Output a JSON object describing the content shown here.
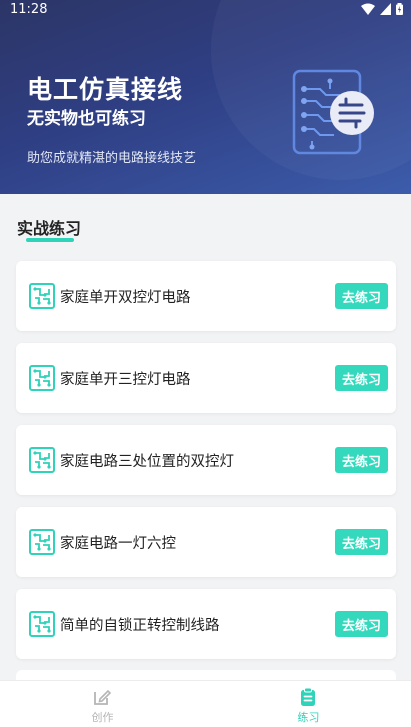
{
  "status": {
    "time": "11:28"
  },
  "hero": {
    "title": "电工仿真接线",
    "subtitle": "无实物也可练习",
    "description": "助您成就精湛的电路接线技艺"
  },
  "section": {
    "title": "实战练习"
  },
  "practice_items": [
    {
      "label": "家庭单开双控灯电路",
      "button": "去练习"
    },
    {
      "label": "家庭单开三控灯电路",
      "button": "去练习"
    },
    {
      "label": "家庭电路三处位置的双控灯",
      "button": "去练习"
    },
    {
      "label": "家庭电路一灯六控",
      "button": "去练习"
    },
    {
      "label": "简单的自锁正转控制线路",
      "button": "去练习"
    }
  ],
  "tabs": [
    {
      "label": "创作",
      "icon": "edit-icon",
      "active": false
    },
    {
      "label": "练习",
      "icon": "clipboard-icon",
      "active": true
    }
  ],
  "colors": {
    "accent": "#34d9bd",
    "hero_start": "#2c3566",
    "hero_end": "#3c5cab",
    "tab_active": "#2fd3ba",
    "tab_inactive": "#b5b5b5"
  }
}
